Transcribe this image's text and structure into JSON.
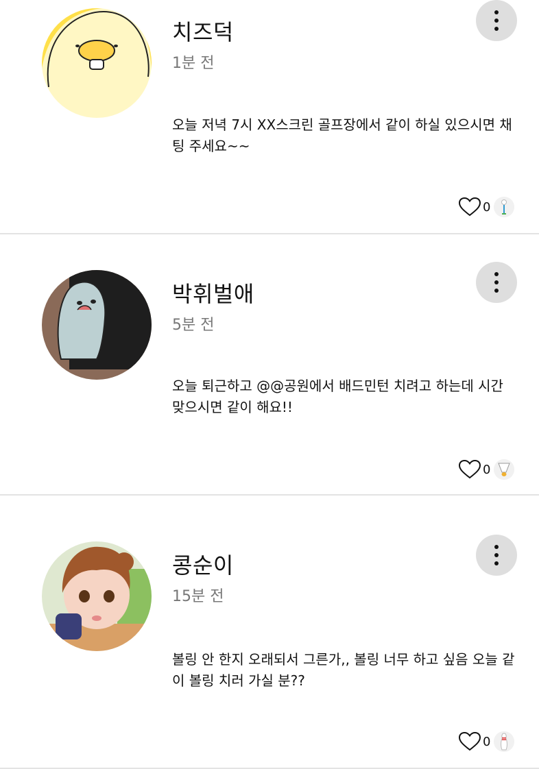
{
  "posts": [
    {
      "author": "치즈덕",
      "time": "1분 전",
      "body": "오늘 저녁 7시 XX스크린 골프장에서 같이 하실 있으시면 채팅 주세요~~",
      "likes": "0",
      "avatar_icon": "duck-avatar",
      "sport_icon": "golf-icon"
    },
    {
      "author": "박휘벌애",
      "time": "5분 전",
      "body": "오늘 퇴근하고 @@공원에서 배드민턴 치려고 하는데 시간 맞으시면 같이 해요!!",
      "likes": "0",
      "avatar_icon": "blob-avatar",
      "sport_icon": "badminton-icon"
    },
    {
      "author": "콩순이",
      "time": "15분 전",
      "body": "볼링 안 한지 오래되서 그른가,, 볼링 너무 하고 싶음 오늘 같이 볼링 치러 가실 분??",
      "likes": "0",
      "avatar_icon": "girl-avatar",
      "sport_icon": "bowling-icon"
    }
  ],
  "colors": {
    "text": "#111111",
    "muted": "#777777",
    "divider": "#e3e3e3",
    "more_button_bg": "#dedede"
  }
}
